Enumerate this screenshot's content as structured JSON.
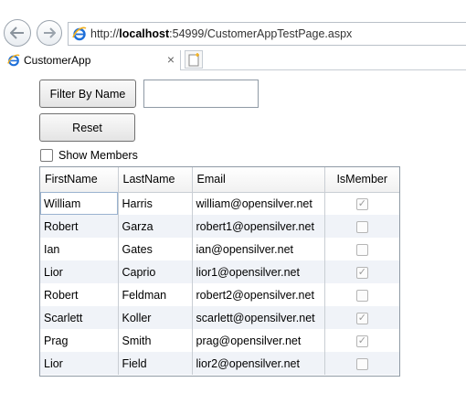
{
  "browser": {
    "url_prefix": "http://",
    "url_host": "localhost",
    "url_rest": ":54999/CustomerAppTestPage.aspx",
    "tab_title": "CustomerApp",
    "tab_close_glyph": "×",
    "back_icon": "back-arrow-icon",
    "forward_icon": "forward-arrow-icon",
    "accent_color": "#1e6fd9"
  },
  "app": {
    "filter_button_label": "Filter By Name",
    "name_filter_value": "",
    "reset_button_label": "Reset",
    "show_members_label": "Show Members",
    "show_members_checked": false
  },
  "grid": {
    "columns": [
      "FirstName",
      "LastName",
      "Email",
      "IsMember"
    ],
    "rows": [
      {
        "first": "William",
        "last": "Harris",
        "email": "william@opensilver.net",
        "member": true
      },
      {
        "first": "Robert",
        "last": "Garza",
        "email": "robert1@opensilver.net",
        "member": false
      },
      {
        "first": "Ian",
        "last": "Gates",
        "email": "ian@opensilver.net",
        "member": false
      },
      {
        "first": "Lior",
        "last": "Caprio",
        "email": "lior1@opensilver.net",
        "member": true
      },
      {
        "first": "Robert",
        "last": "Feldman",
        "email": "robert2@opensilver.net",
        "member": false
      },
      {
        "first": "Scarlett",
        "last": "Koller",
        "email": "scarlett@opensilver.net",
        "member": true
      },
      {
        "first": "Prag",
        "last": "Smith",
        "email": "prag@opensilver.net",
        "member": true
      },
      {
        "first": "Lior",
        "last": "Field",
        "email": "lior2@opensilver.net",
        "member": false
      }
    ],
    "check_glyph": "✓"
  }
}
